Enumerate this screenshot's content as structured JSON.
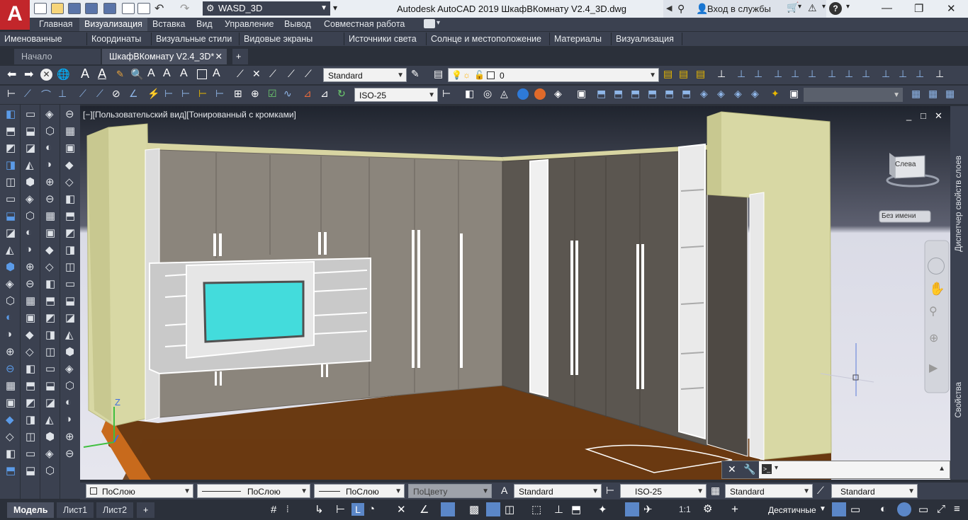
{
  "app": {
    "logo_letter": "A",
    "title": "Autodesk AutoCAD 2019    ШкафВКомнату V2.4_3D.dwg",
    "workspace": "WASD_3D",
    "login": "Вход в службы"
  },
  "ribbon": {
    "tabs": [
      "Главная",
      "Визуализация",
      "Вставка",
      "Вид",
      "Управление",
      "Вывод",
      "Совместная работа"
    ],
    "active_tab": "Визуализация",
    "panels": [
      "Именованные виды",
      "Координаты",
      "Визуальные стили",
      "Видовые экраны модели",
      "Источники света",
      "Солнце и местоположение",
      "Материалы",
      "Визуализация"
    ]
  },
  "file_tabs": {
    "start": "Начало",
    "current": "ШкафВКомнату V2.4_3D*",
    "add": "+"
  },
  "toolbar1": {
    "text_style": "Standard",
    "layer": "0"
  },
  "toolbar2": {
    "dim_style": "ISO-25"
  },
  "viewport": {
    "label": "[−][Пользовательский вид][Тонированный с кромками]",
    "viewcube_face": "Слева",
    "viewcube_label": "Без имени",
    "ucs_z": "Z",
    "controls": [
      "_",
      "□",
      "✕"
    ]
  },
  "right_palettes": {
    "top": "Диспетчер свойств слоев",
    "bottom": "Свойства"
  },
  "properties_bar": {
    "color": "ПоСлою",
    "linetype": "ПоСлою",
    "lineweight": "ПоСлою",
    "plotstyle": "ПоЦвету",
    "text_style": "Standard",
    "dim_style": "ISO-25",
    "table_style": "Standard",
    "mleader_style": "Standard"
  },
  "status": {
    "tabs": [
      "Модель",
      "Лист1",
      "Лист2"
    ],
    "active": "Модель",
    "scale": "1:1",
    "units": "Десятичные"
  }
}
